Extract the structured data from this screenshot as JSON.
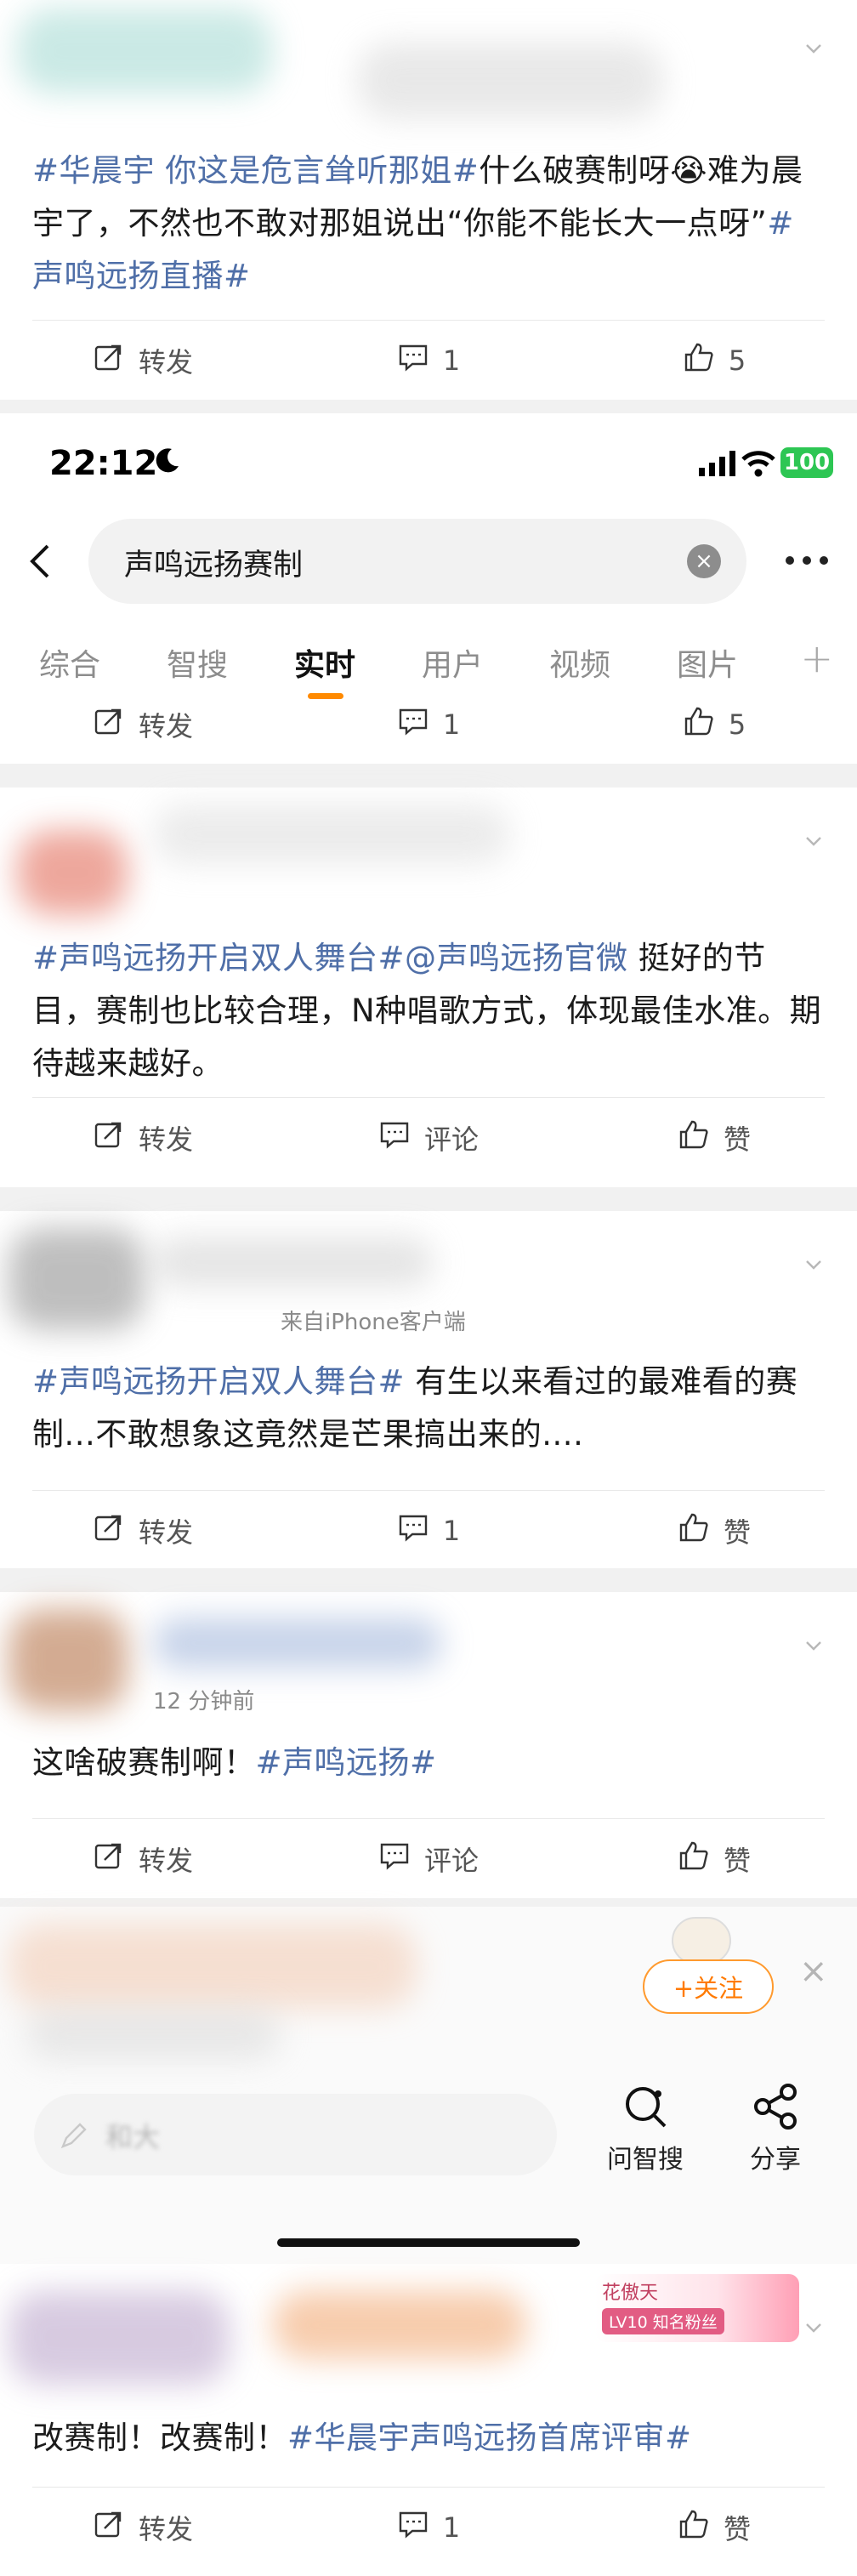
{
  "posts": [
    {
      "text": [
        {
          "t": "#华晨宇 你这是危言耸听那姐#",
          "tag": true
        },
        {
          "t": "什么破赛制呀😭难为晨宇了，不然也不敢对那姐说出“你能不能长大一点呀”",
          "tag": false
        },
        {
          "t": "#声鸣远扬直播#",
          "tag": true
        }
      ],
      "repost": "转发",
      "comment": "1",
      "like": "5"
    },
    {
      "text": [
        {
          "t": "#声鸣远扬开启双人舞台#",
          "tag": true
        },
        {
          "t": "@声鸣远扬官微",
          "tag": true
        },
        {
          "t": " 挺好的节目，赛制也比较合理，N种唱歌方式，体现最佳水准。期待越来越好。",
          "tag": false
        }
      ],
      "repost": "转发",
      "comment": "评论",
      "like": "赞"
    },
    {
      "meta": "来自iPhone客户端",
      "text": [
        {
          "t": "#声鸣远扬开启双人舞台#",
          "tag": true
        },
        {
          "t": " 有生以来看过的最难看的赛制...不敢想象这竟然是芒果搞出来的....",
          "tag": false
        }
      ],
      "repost": "转发",
      "comment": "1",
      "like": "赞"
    },
    {
      "meta": "12 分钟前",
      "text": [
        {
          "t": "这啥破赛制啊！",
          "tag": false
        },
        {
          "t": "#声鸣远扬#",
          "tag": true
        }
      ],
      "repost": "转发",
      "comment": "评论",
      "like": "赞"
    },
    {
      "text": [
        {
          "t": "改赛制！改赛制！",
          "tag": false
        },
        {
          "t": "#华晨宇声鸣远扬首席评审#",
          "tag": true
        }
      ],
      "repost": "转发",
      "comment": "1",
      "like": "赞"
    }
  ],
  "status_bar": {
    "time": "22:12",
    "battery": "100"
  },
  "search": {
    "query": "声鸣远扬赛制",
    "clear_glyph": "×"
  },
  "tabs": [
    {
      "label": "综合"
    },
    {
      "label": "智搜"
    },
    {
      "label": "实时",
      "active": true
    },
    {
      "label": "用户"
    },
    {
      "label": "视频"
    },
    {
      "label": "图片"
    }
  ],
  "tab_plus": "+",
  "top_actions": {
    "repost": "转发",
    "comment": "1",
    "like": "5"
  },
  "follow_button": "+关注",
  "close_glyph": "×",
  "comment_placeholder": "和大",
  "tools": {
    "ask": "问智搜",
    "share": "分享"
  },
  "fan_badge": {
    "name": "花傲天",
    "level": "LV10 知名粉丝"
  },
  "colors": {
    "tag": "#4f6fa8",
    "accent": "#ff8a00",
    "battery": "#2dc653"
  }
}
